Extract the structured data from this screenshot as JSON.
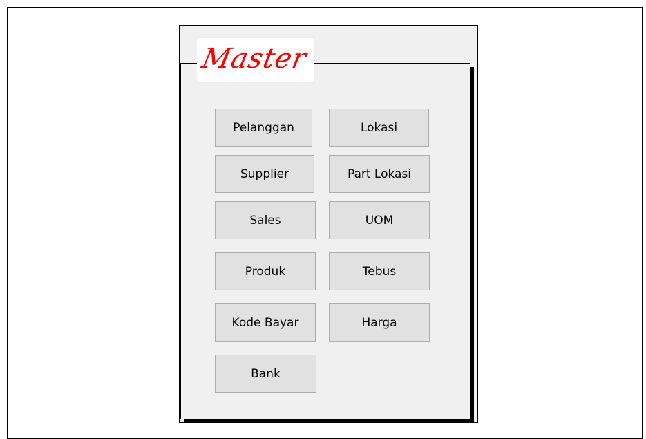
{
  "window": {
    "title": "Master"
  },
  "buttons": {
    "pelanggan": "Pelanggan",
    "lokasi": "Lokasi",
    "supplier": "Supplier",
    "part_lokasi": "Part Lokasi",
    "sales": "Sales",
    "uom": "UOM",
    "produk": "Produk",
    "tebus": "Tebus",
    "kode_bayar": "Kode Bayar",
    "harga": "Harga",
    "bank": "Bank"
  },
  "colors": {
    "title": "#ff0000",
    "panel_background": "#f0f0f0",
    "button_background": "#e1e1e1",
    "button_border": "#adadad"
  }
}
